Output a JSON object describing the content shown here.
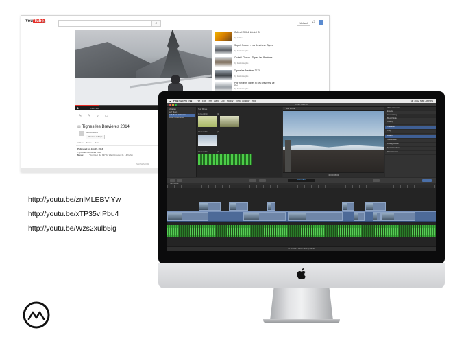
{
  "youtube": {
    "logo_you": "You",
    "logo_tube": "Tube",
    "country": "FR",
    "search_placeholder": "",
    "upload_label": "Upload",
    "video": {
      "title": "Tignes les Brevières 2014",
      "channel": "Matt Josephs",
      "subscribe_label": "Channel settings",
      "time": "0:49 / 3:09",
      "published": "Published on Jan 15, 2014",
      "description": "Tignes les Brevières 2014",
      "music_key": "Music",
      "music_value": "\"Don't Let Me Kill\" by Walt Dresden Ft. I-Rhythm",
      "show_more": "SHOW MORE",
      "actions": [
        "Add to",
        "Share",
        "More"
      ]
    },
    "sidebar": [
      {
        "title": "GoPro HERO4: Life in HD",
        "sub": "by GoPro"
      },
      {
        "title": "Superb Powder - Les Brevières - Tignes",
        "sub": "by Matt Josephs"
      },
      {
        "title": "Chalet L'Ourson - Tignes Les Brevières",
        "sub": "by Matt Josephs"
      },
      {
        "title": "Tignes les Brevières 2013",
        "sub": "by Matt Josephs"
      },
      {
        "title": "Pow run from Tignes to Les Brevières, Le Ski",
        "sub": "by Matt Josephs"
      }
    ]
  },
  "links": [
    "http://youtu.be/znlMLEBViYw",
    "http://youtu.be/xTP35vIPbu4",
    "http://youtu.be/Wzs2xulb5ig"
  ],
  "fcp": {
    "menu": [
      "Final Cut Pro Trial",
      "File",
      "Edit",
      "Trim",
      "Mark",
      "Clip",
      "Modify",
      "View",
      "Window",
      "Help"
    ],
    "menu_right": "Tue 15:32  Matt Josephs",
    "window_title": "Final Cut Pro",
    "libraries": [
      "Libraries",
      "Surf Movie",
      "Surf Movie Animated",
      "Smart Collections"
    ],
    "browser_head": "Surf Movie",
    "dates": [
      "11 Dec 2014",
      "12 Dec 2014",
      "13 Dec 2014"
    ],
    "clip_counts": [
      "(2)",
      "(1)",
      "(1)"
    ],
    "viewer_head": "Surf Movie",
    "timecode": "00:00:08:04",
    "inspector": [
      "Video Animation",
      "Effects",
      "Compositing",
      "Blend Mode",
      "Opacity",
      "Transform",
      "Crop",
      "Distort",
      "Stabilization",
      "Rolling Shutter",
      "Spatial Conform",
      "Rate Conform"
    ],
    "timeline_head": "Surf Movie",
    "status": "00:00 total · 1080p HD 25p Stereo"
  }
}
